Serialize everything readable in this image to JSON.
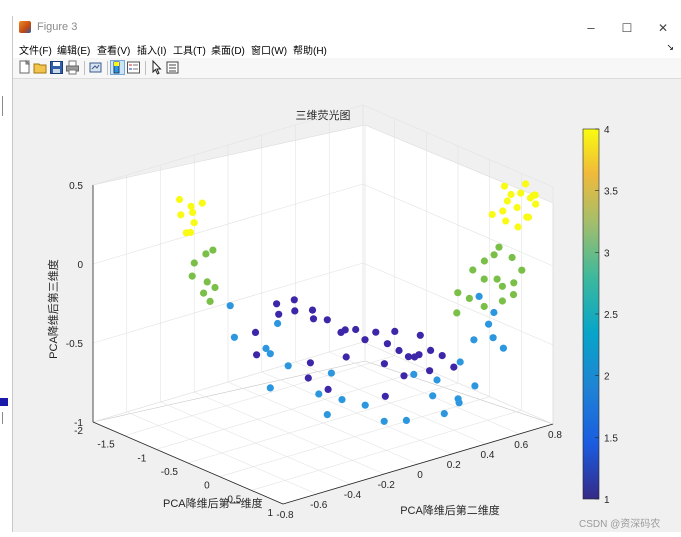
{
  "window": {
    "title": "Figure 3",
    "minimize_glyph": "–",
    "maximize_glyph": "☐",
    "close_glyph": "✕"
  },
  "menu": {
    "items": [
      {
        "label": "文件(F)"
      },
      {
        "label": "编辑(E)"
      },
      {
        "label": "查看(V)"
      },
      {
        "label": "插入(I)"
      },
      {
        "label": "工具(T)"
      },
      {
        "label": "桌面(D)"
      },
      {
        "label": "窗口(W)"
      },
      {
        "label": "帮助(H)"
      }
    ],
    "overflow_glyph": "↘"
  },
  "toolbar": {
    "buttons": [
      {
        "name": "new-figure-icon"
      },
      {
        "name": "open-file-icon"
      },
      {
        "name": "save-icon"
      },
      {
        "name": "print-icon"
      },
      {
        "name": "link-plot-icon"
      },
      {
        "name": "insert-colorbar-icon"
      },
      {
        "name": "insert-legend-icon"
      },
      {
        "name": "edit-plot-pointer-icon"
      },
      {
        "name": "property-inspector-icon"
      }
    ]
  },
  "watermark": "CSDN @资深码农",
  "colors": {
    "viridis_1": "#3e26a8",
    "viridis_2": "#2c97df",
    "viridis_3": "#79bf48",
    "viridis_4": "#f9fb15"
  },
  "chart_data": {
    "type": "scatter3d",
    "title": "三维荧光图",
    "xlabel": "PCA降维后第一维度",
    "ylabel": "PCA降维后第二维度",
    "zlabel": "PCA降维后第三维度",
    "x_ticks": [
      "-2",
      "-1.5",
      "-1",
      "-0.5",
      "0",
      "0.5",
      "1"
    ],
    "y_ticks": [
      "-0.8",
      "-0.6",
      "-0.4",
      "-0.2",
      "0",
      "0.2",
      "0.4",
      "0.6",
      "0.8"
    ],
    "z_ticks": [
      "-1",
      "-0.5",
      "0",
      "0.5"
    ],
    "xlim": [
      -2,
      1
    ],
    "ylim": [
      -0.8,
      0.8
    ],
    "zlim": [
      -1,
      0.5
    ],
    "grid": true,
    "colorbar": {
      "min": 1,
      "max": 4,
      "ticks": [
        "1",
        "1.5",
        "2",
        "2.5",
        "3",
        "3.5",
        "4"
      ],
      "colormap": "parula"
    },
    "series": [
      {
        "class": 1,
        "points": [
          [
            -0.3,
            -0.35,
            -0.1
          ],
          [
            -0.2,
            -0.28,
            -0.15
          ],
          [
            -0.1,
            -0.32,
            -0.05
          ],
          [
            0.0,
            -0.25,
            -0.12
          ],
          [
            0.1,
            -0.2,
            -0.18
          ],
          [
            -0.4,
            -0.3,
            -0.2
          ],
          [
            -0.25,
            -0.15,
            -0.25
          ],
          [
            0.05,
            -0.1,
            -0.3
          ],
          [
            0.15,
            -0.05,
            -0.28
          ],
          [
            -0.15,
            0.0,
            -0.35
          ],
          [
            0.2,
            0.05,
            -0.32
          ],
          [
            0.25,
            0.1,
            -0.4
          ],
          [
            -0.05,
            0.08,
            -0.42
          ],
          [
            0.3,
            0.15,
            -0.45
          ],
          [
            0.1,
            0.2,
            -0.38
          ],
          [
            0.35,
            0.25,
            -0.5
          ],
          [
            0.4,
            0.3,
            -0.48
          ],
          [
            0.2,
            0.28,
            -0.55
          ],
          [
            0.45,
            0.35,
            -0.52
          ],
          [
            0.5,
            0.4,
            -0.6
          ],
          [
            -0.5,
            -0.4,
            -0.3
          ],
          [
            -0.35,
            -0.45,
            -0.4
          ],
          [
            0.0,
            -0.05,
            -0.48
          ],
          [
            0.15,
            0.12,
            -0.55
          ],
          [
            -0.2,
            -0.2,
            -0.6
          ],
          [
            0.3,
            0.18,
            -0.62
          ],
          [
            0.05,
            0.3,
            -0.58
          ],
          [
            0.25,
            0.35,
            -0.65
          ],
          [
            -0.1,
            -0.12,
            -0.68
          ],
          [
            0.35,
            0.05,
            -0.7
          ],
          [
            0.45,
            0.22,
            -0.35
          ],
          [
            0.1,
            -0.3,
            -0.42
          ]
        ]
      },
      {
        "class": 2,
        "points": [
          [
            -0.9,
            -0.4,
            -0.2
          ],
          [
            -0.6,
            -0.3,
            -0.45
          ],
          [
            -0.8,
            -0.2,
            -0.55
          ],
          [
            -0.4,
            -0.35,
            -0.65
          ],
          [
            -0.3,
            -0.1,
            -0.75
          ],
          [
            -0.2,
            0.0,
            -0.8
          ],
          [
            -0.5,
            0.05,
            -0.7
          ],
          [
            0.1,
            -0.2,
            -0.78
          ],
          [
            -0.1,
            0.1,
            -0.85
          ],
          [
            0.2,
            0.1,
            -0.9
          ],
          [
            0.4,
            0.2,
            -0.6
          ],
          [
            0.5,
            0.3,
            -0.65
          ],
          [
            0.6,
            0.4,
            -0.55
          ],
          [
            0.7,
            0.45,
            -0.7
          ],
          [
            0.55,
            0.5,
            -0.45
          ],
          [
            0.65,
            0.55,
            -0.35
          ],
          [
            0.75,
            0.6,
            -0.5
          ],
          [
            0.8,
            0.52,
            -0.4
          ],
          [
            0.3,
            0.35,
            -0.8
          ],
          [
            0.45,
            0.45,
            -0.85
          ],
          [
            -0.7,
            -0.45,
            -0.35
          ],
          [
            -0.55,
            -0.25,
            -0.3
          ],
          [
            0.15,
            0.25,
            -0.95
          ],
          [
            0.35,
            0.4,
            -0.92
          ],
          [
            0.6,
            0.6,
            -0.3
          ],
          [
            0.5,
            0.55,
            -0.2
          ],
          [
            -0.25,
            -0.3,
            -0.5
          ],
          [
            0.7,
            0.35,
            -0.75
          ]
        ]
      },
      {
        "class": 3,
        "points": [
          [
            -1.2,
            -0.5,
            0.05
          ],
          [
            -1.15,
            -0.45,
            0.1
          ],
          [
            -1.1,
            -0.55,
            0.0
          ],
          [
            -1.05,
            -0.48,
            -0.05
          ],
          [
            -1.0,
            -0.52,
            -0.1
          ],
          [
            -0.95,
            -0.5,
            -0.15
          ],
          [
            -1.12,
            -0.42,
            0.12
          ],
          [
            -0.98,
            -0.46,
            -0.08
          ],
          [
            0.4,
            0.55,
            -0.05
          ],
          [
            0.45,
            0.6,
            0.0
          ],
          [
            0.5,
            0.58,
            -0.1
          ],
          [
            0.55,
            0.62,
            0.05
          ],
          [
            0.6,
            0.65,
            -0.15
          ],
          [
            0.65,
            0.6,
            -0.08
          ],
          [
            0.7,
            0.68,
            -0.12
          ],
          [
            0.48,
            0.5,
            -0.2
          ],
          [
            0.58,
            0.55,
            -0.25
          ],
          [
            0.68,
            0.62,
            -0.22
          ],
          [
            0.35,
            0.48,
            -0.18
          ],
          [
            0.62,
            0.7,
            0.02
          ],
          [
            0.72,
            0.72,
            -0.05
          ],
          [
            0.52,
            0.66,
            0.08
          ],
          [
            0.44,
            0.44,
            -0.28
          ],
          [
            0.75,
            0.66,
            -0.18
          ]
        ]
      },
      {
        "class": 4,
        "points": [
          [
            -1.3,
            -0.55,
            0.45
          ],
          [
            -1.25,
            -0.5,
            0.4
          ],
          [
            -1.2,
            -0.58,
            0.38
          ],
          [
            -1.15,
            -0.52,
            0.32
          ],
          [
            -1.1,
            -0.56,
            0.28
          ],
          [
            -1.28,
            -0.48,
            0.35
          ],
          [
            -1.18,
            -0.46,
            0.42
          ],
          [
            -1.22,
            -0.54,
            0.25
          ],
          [
            0.5,
            0.7,
            0.45
          ],
          [
            0.55,
            0.72,
            0.4
          ],
          [
            0.6,
            0.68,
            0.38
          ],
          [
            0.65,
            0.74,
            0.42
          ],
          [
            0.7,
            0.7,
            0.35
          ],
          [
            0.75,
            0.76,
            0.4
          ],
          [
            0.8,
            0.72,
            0.3
          ],
          [
            0.58,
            0.66,
            0.32
          ],
          [
            0.68,
            0.64,
            0.28
          ],
          [
            0.78,
            0.78,
            0.36
          ],
          [
            0.52,
            0.62,
            0.3
          ],
          [
            0.85,
            0.74,
            0.44
          ],
          [
            0.62,
            0.78,
            0.46
          ],
          [
            0.72,
            0.8,
            0.4
          ],
          [
            0.88,
            0.7,
            0.32
          ],
          [
            0.82,
            0.66,
            0.26
          ]
        ]
      }
    ]
  }
}
